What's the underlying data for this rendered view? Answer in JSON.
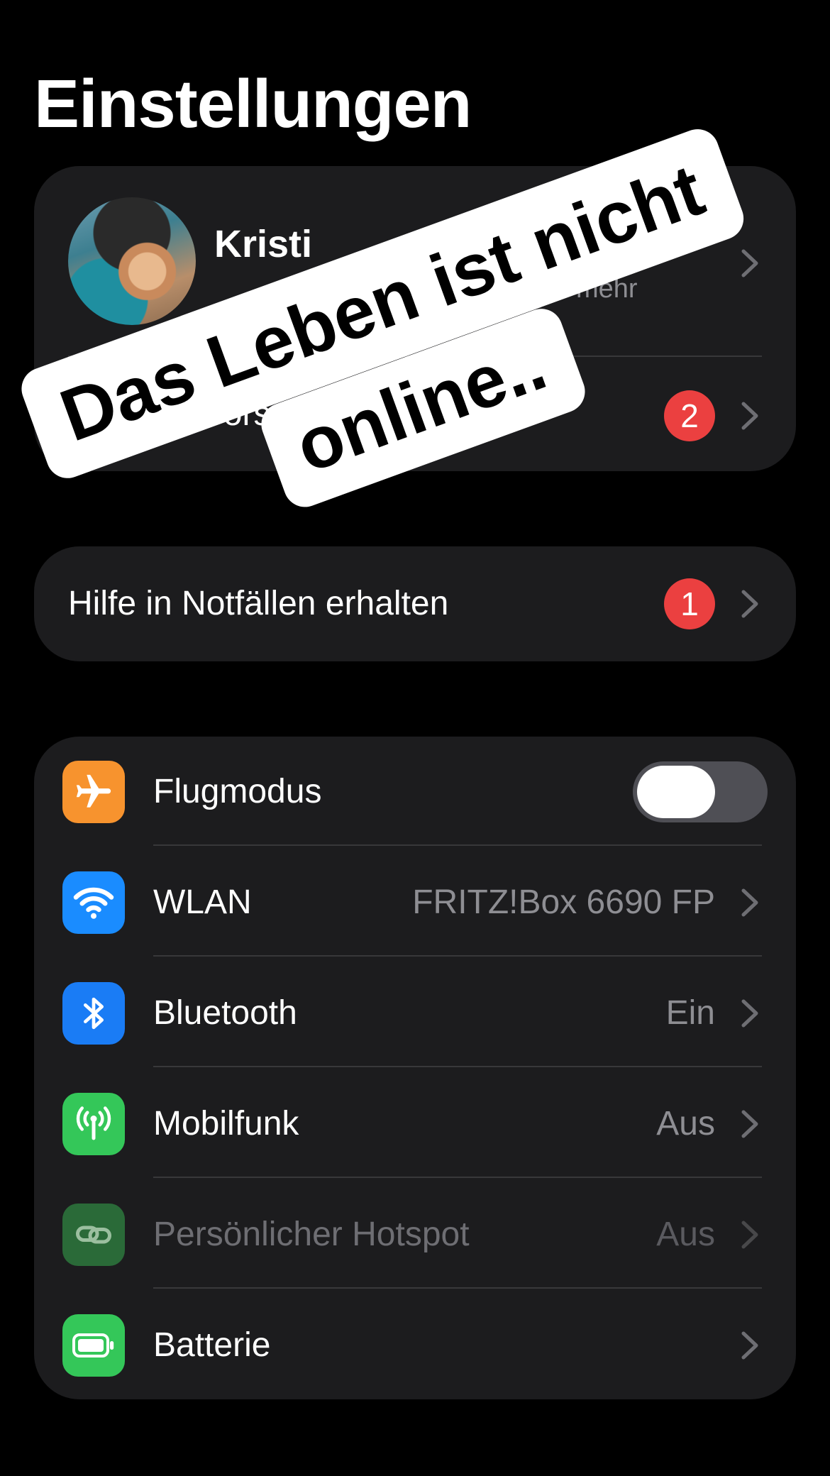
{
  "header": {
    "title": "Einstellungen"
  },
  "profile": {
    "name": "Kristi",
    "subtitle": "und mehr",
    "suggestions_label": "Account-Vorschläge",
    "suggestions_badge": "2"
  },
  "emergency": {
    "label": "Hilfe in Notfällen erhalten",
    "badge": "1"
  },
  "settings": [
    {
      "label": "Flugmodus",
      "value": "",
      "icon": "airplane-icon",
      "color": "#f7932e",
      "toggle": true,
      "toggle_on": false
    },
    {
      "label": "WLAN",
      "value": "FRITZ!Box 6690 FP",
      "icon": "wifi-icon",
      "color": "#1a8cff"
    },
    {
      "label": "Bluetooth",
      "value": "Ein",
      "icon": "bluetooth-icon",
      "color": "#1a7cf5"
    },
    {
      "label": "Mobilfunk",
      "value": "Aus",
      "icon": "antenna-icon",
      "color": "#34c759"
    },
    {
      "label": "Persönlicher Hotspot",
      "value": "Aus",
      "icon": "hotspot-link-icon",
      "color": "#2a6a38",
      "disabled": true
    },
    {
      "label": "Batterie",
      "value": "",
      "icon": "battery-icon",
      "color": "#34c759"
    }
  ],
  "overlay_caption": {
    "line1": "Das Leben ist nicht",
    "line2": "online.."
  }
}
